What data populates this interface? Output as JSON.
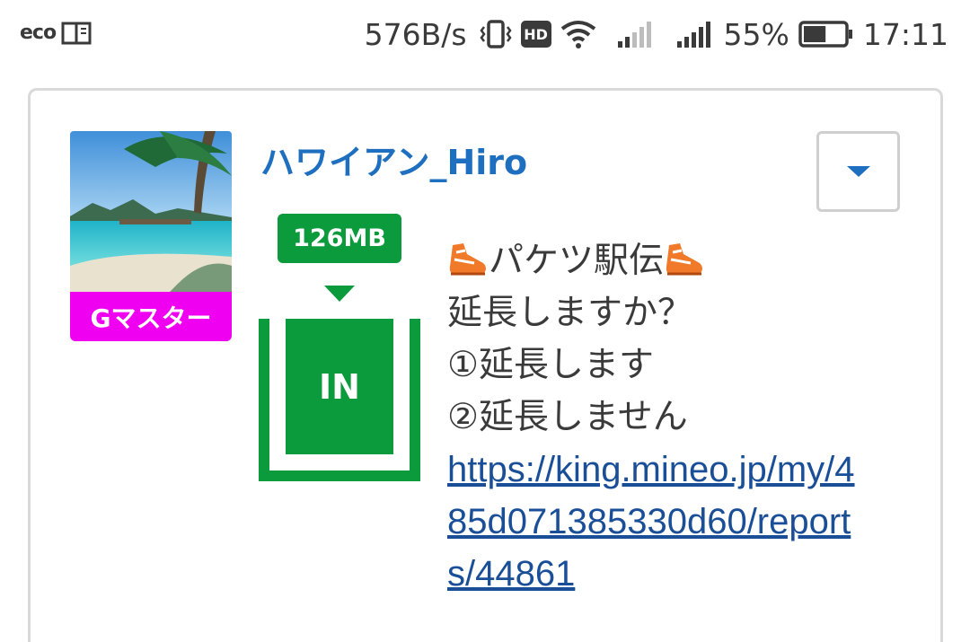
{
  "status_bar": {
    "eco_label": "eco",
    "net_speed": "576B/s",
    "hd_label": "HD",
    "battery_percent": "55%",
    "battery_level": 0.55,
    "time": "17:11",
    "icons": [
      "eco-icon",
      "notebook-icon",
      "vibrate-icon",
      "hd-icon",
      "wifi-icon",
      "signal-icon",
      "signal-icon",
      "battery-icon"
    ]
  },
  "post": {
    "username": "ハワイアン_Hiro",
    "rank": "Gマスター",
    "data_amount": "126MB",
    "tank_label": "IN",
    "message_title": "パケツ駅伝",
    "message_lines": [
      "延長しますか？",
      "①延長します",
      "②延長しません"
    ],
    "link": "https://king.mineo.jp/my/485d071385330d60/reports/44861"
  },
  "colors": {
    "accent_blue": "#1e6fbf",
    "link_blue": "#1a4f98",
    "green": "#0b9b3c",
    "badge_magenta": "#f000f0",
    "shoe_orange": "#f07a2a"
  }
}
